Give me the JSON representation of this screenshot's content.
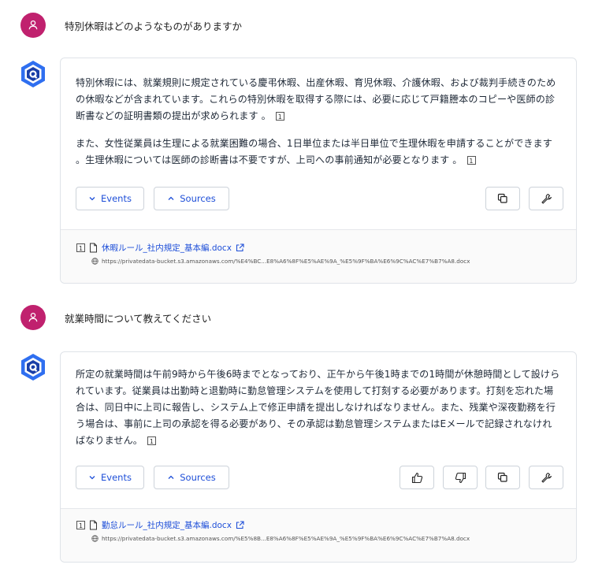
{
  "conversation": [
    {
      "user_text": "特別休暇はどのようなものがありますか",
      "bot": {
        "paragraphs": [
          {
            "text": "特別休暇には、就業規則に規定されている慶弔休暇、出産休暇、育児休暇、介護休暇、および裁判手続きのための休暇などが含まれています。これらの特別休暇を取得する際には、必要に応じて戸籍謄本のコピーや医師の診断書などの証明書類の提出が求められます 。",
            "cite": "1"
          },
          {
            "text": "また、女性従業員は生理による就業困難の場合、1日単位または半日単位で生理休暇を申請することができます 。生理休暇については医師の診断書は不要ですが、上司への事前通知が必要となります 。",
            "cite": "1"
          }
        ],
        "events_label": "Events",
        "sources_label": "Sources",
        "source": {
          "num": "1",
          "title": "休暇ルール_社内規定_基本編.docx",
          "url": "https://privatedata-bucket.s3.amazonaws.com/%E4%BC...E8%A6%8F%E5%AE%9A_%E5%9F%BA%E6%9C%AC%E7%B7%A8.docx"
        }
      }
    },
    {
      "user_text": "就業時間について教えてください",
      "bot": {
        "paragraphs": [
          {
            "text": "所定の就業時間は午前9時から午後6時までとなっており、正午から午後1時までの1時間が休憩時間として設けられています。従業員は出勤時と退勤時に勤怠管理システムを使用して打刻する必要があります。打刻を忘れた場合は、同日中に上司に報告し、システム上で修正申請を提出しなければなりません。また、残業や深夜勤務を行う場合は、事前に上司の承認を得る必要があり、その承認は勤怠管理システムまたはEメールで記録されなければなりません。",
            "cite": "1"
          }
        ],
        "events_label": "Events",
        "sources_label": "Sources",
        "source": {
          "num": "1",
          "title": "勤怠ルール_社内規定_基本編.docx",
          "url": "https://privatedata-bucket.s3.amazonaws.com/%E5%8B...E8%A6%8F%E5%AE%9A_%E5%9F%BA%E6%9C%AC%E7%B7%A8.docx"
        }
      }
    }
  ],
  "icons": {
    "user": "user-icon",
    "bot": "bot-logo-icon",
    "expand": "chevron-down-icon",
    "collapse": "chevron-up-icon",
    "copy": "copy-icon",
    "settings": "wrench-icon",
    "like": "thumbs-up-icon",
    "dislike": "thumbs-down-icon",
    "document": "document-icon",
    "external": "external-link-icon",
    "globe": "globe-icon"
  },
  "colors": {
    "user_avatar": "#c0216e",
    "bot_logo_outer": "#2f6ff0",
    "bot_logo_inner": "#1a3fa8",
    "link": "#1d4ed8"
  }
}
